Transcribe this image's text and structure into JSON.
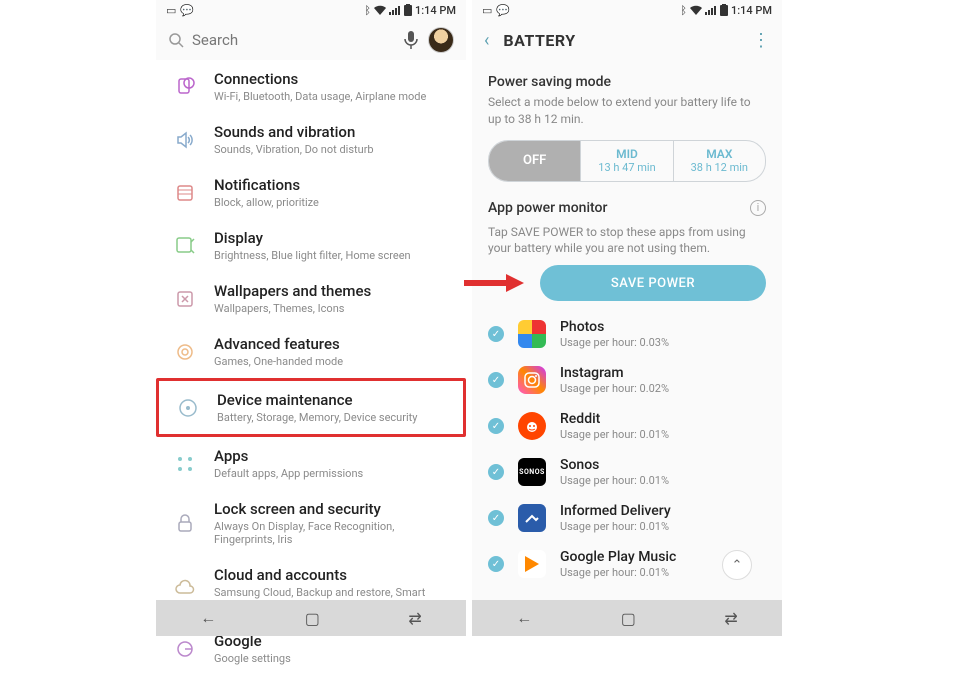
{
  "status": {
    "time": "1:14 PM"
  },
  "search": {
    "placeholder": "Search"
  },
  "settings": [
    {
      "title": "Connections",
      "sub": "Wi-Fi, Bluetooth, Data usage, Airplane mode"
    },
    {
      "title": "Sounds and vibration",
      "sub": "Sounds, Vibration, Do not disturb"
    },
    {
      "title": "Notifications",
      "sub": "Block, allow, prioritize"
    },
    {
      "title": "Display",
      "sub": "Brightness, Blue light filter, Home screen"
    },
    {
      "title": "Wallpapers and themes",
      "sub": "Wallpapers, Themes, Icons"
    },
    {
      "title": "Advanced features",
      "sub": "Games, One-handed mode"
    },
    {
      "title": "Device maintenance",
      "sub": "Battery, Storage, Memory, Device security"
    },
    {
      "title": "Apps",
      "sub": "Default apps, App permissions"
    },
    {
      "title": "Lock screen and security",
      "sub": "Always On Display, Face Recognition, Fingerprints, Iris"
    },
    {
      "title": "Cloud and accounts",
      "sub": "Samsung Cloud, Backup and restore, Smart Switch"
    },
    {
      "title": "Google",
      "sub": "Google settings"
    }
  ],
  "battery": {
    "header": "BATTERY",
    "psm_title": "Power saving mode",
    "psm_sub": "Select a mode below to extend your battery life to up to 38 h 12 min.",
    "modes": {
      "off": "OFF",
      "mid": {
        "name": "MID",
        "est": "13 h 47 min"
      },
      "max": {
        "name": "MAX",
        "est": "38 h 12 min"
      }
    },
    "apm_title": "App power monitor",
    "apm_sub": "Tap SAVE POWER to stop these apps from using your battery while you are not using them.",
    "save_btn": "SAVE POWER",
    "apps": [
      {
        "name": "Photos",
        "usage": "Usage per hour: 0.03%"
      },
      {
        "name": "Instagram",
        "usage": "Usage per hour: 0.02%"
      },
      {
        "name": "Reddit",
        "usage": "Usage per hour: 0.01%"
      },
      {
        "name": "Sonos",
        "usage": "Usage per hour: 0.01%"
      },
      {
        "name": "Informed Delivery",
        "usage": "Usage per hour: 0.01%"
      },
      {
        "name": "Google Play Music",
        "usage": "Usage per hour: 0.01%"
      }
    ]
  }
}
